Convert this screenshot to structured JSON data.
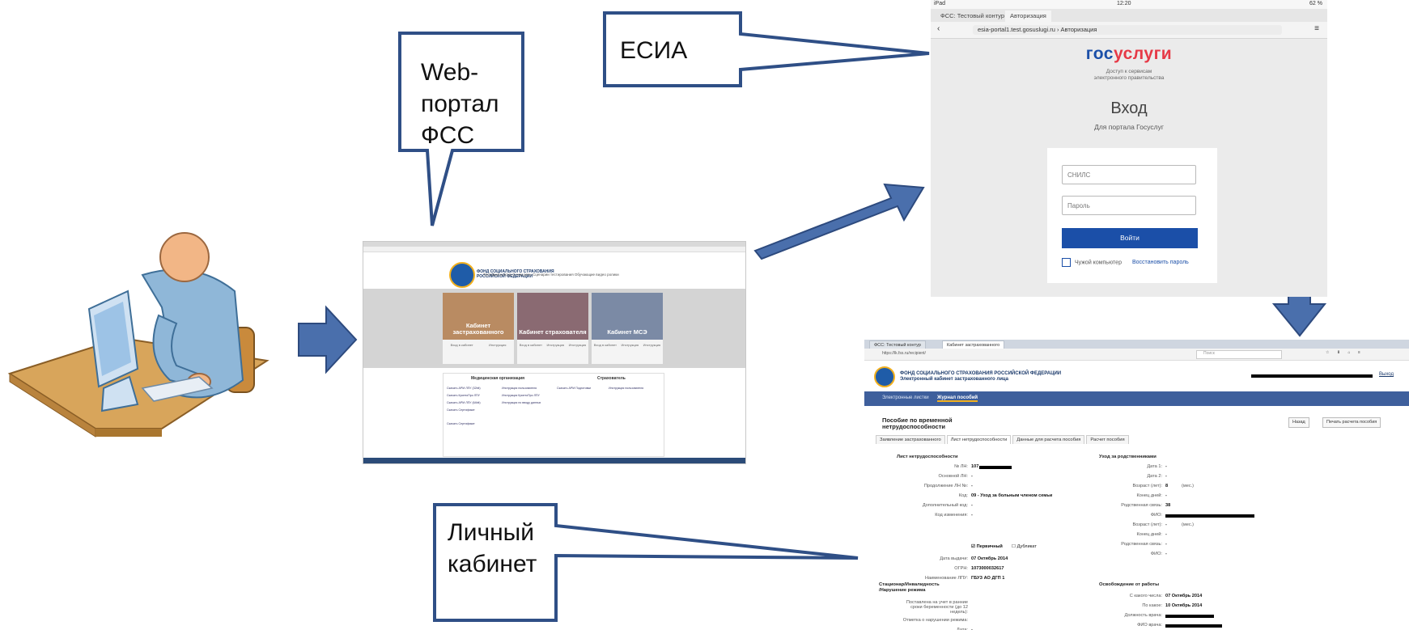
{
  "callouts": {
    "web_portal": [
      "Web-",
      "портал",
      "ФСС"
    ],
    "esia": "ЕСИА",
    "cabinet": [
      "Личный",
      "кабинет"
    ]
  },
  "colors": {
    "arrow_fill": "#4a6fac",
    "arrow_stroke": "#2d4a7e",
    "callout_border": "#2f4f86"
  },
  "portal": {
    "org_name": [
      "ФОНД СОЦИАЛЬНОГО СТРАХОВАНИЯ",
      "РОССИЙСКОЙ ФЕДЕРАЦИИ"
    ],
    "links": "Тестовый контур   О чем речь   Сценарии тестирования   Обучающие видео ролики",
    "cards": [
      {
        "title": "Кабинет застрахованного",
        "color": "#b98b62"
      },
      {
        "title": "Кабинет страхователя",
        "color": "#8a6a72"
      },
      {
        "title": "Кабинет МСЭ",
        "color": "#7b8aa5"
      }
    ],
    "card_icons": [
      "Вход в кабинет",
      "Инструкция",
      "Инструкция"
    ],
    "columns": [
      "Медицинская организация",
      "Страхователь"
    ],
    "med_items": [
      "Скачать АРМ ЛПУ (32bit)",
      "Скачать КриптоПро ЛПУ",
      "Скачать АРМ ЛПУ (64bit)",
      "Скачать Сертификат",
      "Скачать Сертификат"
    ],
    "ins_items": [
      "Инструкция пользователя",
      "Инструкция КриптоПро ЛПУ",
      "Инструкция по вводу данных"
    ],
    "emp_items": [
      "Скачать АРМ Подготовки",
      "Инструкция пользователя"
    ]
  },
  "gosuslugi": {
    "status_left": "iPad",
    "status_time": "12:20",
    "status_right": "62 %",
    "tabs": [
      "ФСС: Тестовый контур",
      "Авторизация"
    ],
    "url": "esia-portal1.test.gosuslugi.ru › Авторизация",
    "brand_a": "гос",
    "brand_b": "услуги",
    "brand_sub": [
      "Доступ к сервисам",
      "электронного правительства"
    ],
    "title": "Вход",
    "subtitle": "Для портала Госуслуг",
    "snils_placeholder": "СНИЛС",
    "password_placeholder": "Пароль",
    "login_button": "Войти",
    "foreign_pc": "Чужой компьютер",
    "restore_link": "Восстановить пароль"
  },
  "cabinet": {
    "tabs": [
      "ФСС: Тестовый контур",
      "Кабинет застрахованного"
    ],
    "url": "https://lk.fss.ru/recipient/",
    "search": "Поиск",
    "org": [
      "ФОНД СОЦИАЛЬНОГО СТРАХОВАНИЯ РОССИЙСКОЙ ФЕДЕРАЦИИ",
      "Электронный кабинет застрахованного лица"
    ],
    "exit": "Выход",
    "nav": [
      "Электронные листки",
      "Журнал пособий"
    ],
    "page_title": [
      "Пособие по временной",
      "нетрудоспособности"
    ],
    "back": "Назад",
    "print": "Печать расчета пособия",
    "subtabs": [
      "Заявление застрахованного",
      "Лист нетрудоспособности",
      "Данные для расчета пособия",
      "Расчет пособия"
    ],
    "left_section": "Лист нетрудоспособности",
    "right_section": "Уход за родственниками",
    "left_rows": [
      {
        "label": "№ ЛН:",
        "value": "107"
      },
      {
        "label": "Основной ЛН:",
        "value": "-"
      },
      {
        "label": "Продолжение ЛН №:",
        "value": "-"
      },
      {
        "label": "Код:",
        "value": "09 - Уход за больным членом семьи"
      },
      {
        "label": "Дополнительный код:",
        "value": "-"
      },
      {
        "label": "Код изменения:",
        "value": "-"
      }
    ],
    "primary": "Первичный",
    "duplicate": "Дубликат",
    "left_rows2": [
      {
        "label": "Дата выдачи:",
        "value": "07 Октябрь 2014"
      },
      {
        "label": "ОГРН:",
        "value": "1073000032617"
      },
      {
        "label": "Наименование ЛПУ:",
        "value": "ГБУЗ АО ДГП 1"
      }
    ],
    "right_rows": [
      {
        "label": "Дата 1:",
        "value": "-"
      },
      {
        "label": "Дата 2:",
        "value": "-"
      },
      {
        "label": "Возраст (лет):",
        "value": "8"
      },
      {
        "label": "Конец дней:",
        "value": "-"
      },
      {
        "label": "Родственная связь:",
        "value": "38"
      },
      {
        "label": "ФИО:",
        "value": ""
      },
      {
        "label": "Возраст (лет):",
        "value": "-"
      },
      {
        "label": "Конец дней:",
        "value": "-"
      },
      {
        "label": "Родственная связь:",
        "value": "-"
      },
      {
        "label": "ФИО:",
        "value": "-"
      }
    ],
    "months_label": "(мес.)",
    "stat_section": [
      "Стационар/Инвалидность",
      "/Нарушение режима"
    ],
    "stat_rows": [
      {
        "label": "Поставлена на учет в ранние сроки беременности (до 12 недель):"
      },
      {
        "label": "Отметка о нарушении режима:"
      },
      {
        "label": "Дата:",
        "value": "-"
      }
    ],
    "release_section": "Освобождение от работы",
    "release_rows": [
      {
        "label": "С какого числа:",
        "value": "07 Октябрь 2014"
      },
      {
        "label": "По какое:",
        "value": "10 Октябрь 2014"
      },
      {
        "label": "Должность врача:",
        "value": ""
      },
      {
        "label": "ФИО врача:",
        "value": ""
      }
    ]
  }
}
